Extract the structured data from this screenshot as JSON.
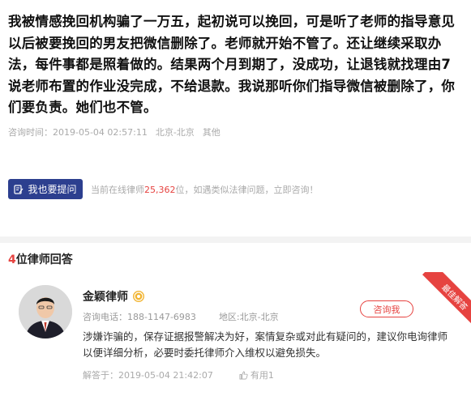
{
  "question": {
    "text": "我被情感挽回机构骗了一万五，起初说可以挽回，可是听了老师的指导意见以后被要挽回的男友把微信删除了。老师就开始不管了。还让继续采取办法，每件事都是照着做的。结果两个月到期了，没成功，让退钱就找理由7说老师布置的作业没完成，不给退款。我说那听你们指导微信被删除了，你们要负责。她们也不管。",
    "time": "咨询时间：2019-05-04 02:57:11",
    "location": "北京-北京",
    "category": "其他"
  },
  "ask": {
    "button_label": "我也要提问",
    "hint_prefix": "当前在线律师",
    "online_count": "25,362",
    "hint_suffix": "位，如遇类似法律问题，立即咨询！"
  },
  "answers": {
    "count": "4",
    "header_label": "位律师回答"
  },
  "answer": {
    "lawyer_name": "金颖律师",
    "phone": "咨询电话：188-1147-6983",
    "region": "地区:北京-北京",
    "consult_label": "咨询我",
    "ribbon_label": "最佳解答",
    "text": "涉嫌诈骗的，保存证据报警解决为好，案情复杂或对此有疑问的，建议你电询律师以便详细分析，必要时委托律师介入维权以避免损失。",
    "answered_time": "解答于：2019-05-04 21:42:07",
    "helpful_label": "有用1"
  },
  "colors": {
    "accent_red": "#e64340",
    "button_blue": "#2c3f8f",
    "badge_gold": "#f2b533"
  },
  "icons": {
    "ask": "edit-note-icon",
    "badge": "verified-badge-icon",
    "helpful": "thumbs-up-icon"
  }
}
